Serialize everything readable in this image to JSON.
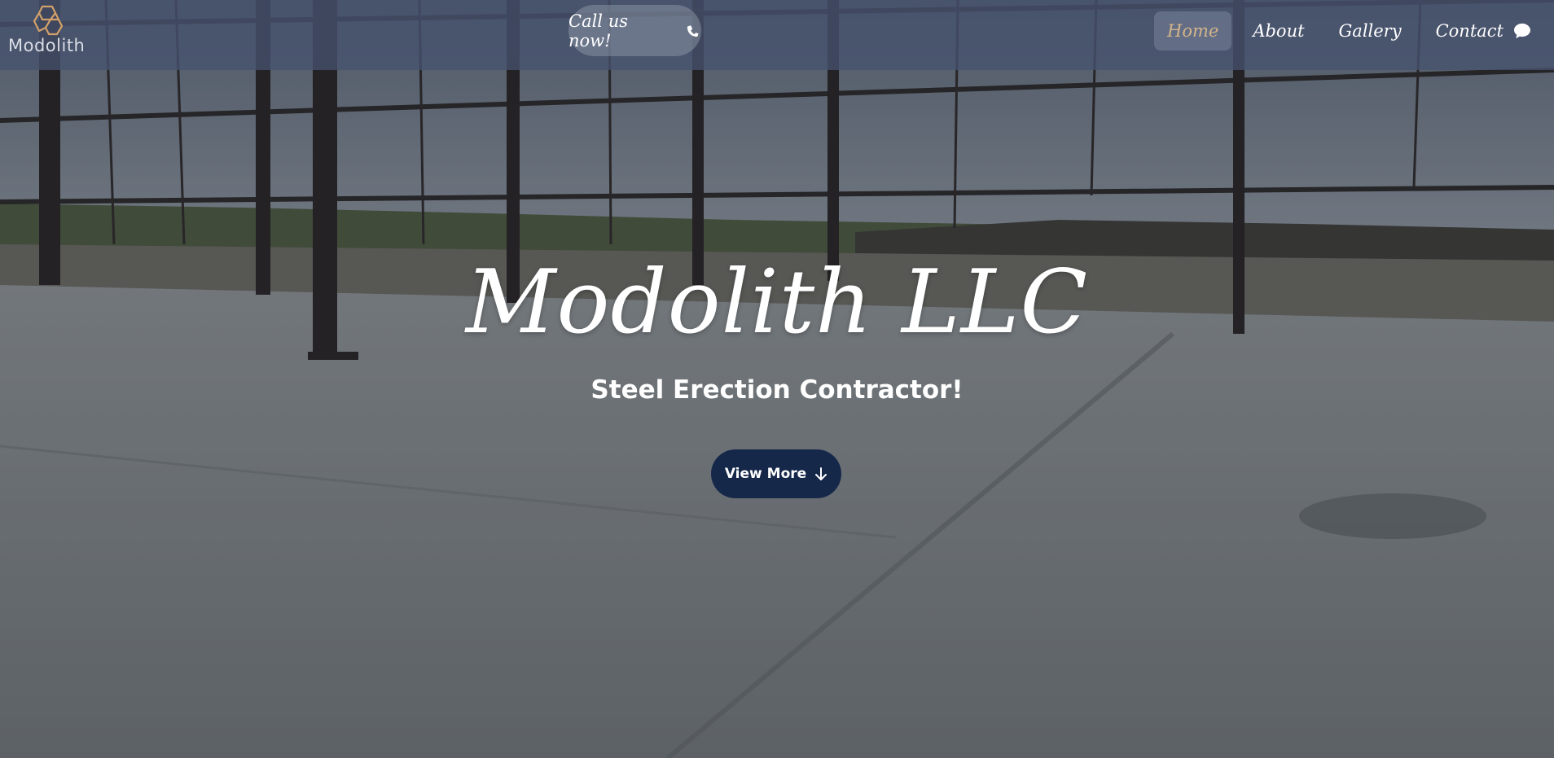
{
  "brand": {
    "name": "Modolith"
  },
  "header": {
    "call_label": "Call us now!",
    "call_icon": "phone-icon",
    "nav": [
      {
        "label": "Home",
        "active": true
      },
      {
        "label": "About",
        "active": false
      },
      {
        "label": "Gallery",
        "active": false
      },
      {
        "label": "Contact",
        "icon": "chat-bubble-icon",
        "active": false
      }
    ]
  },
  "hero": {
    "title": "Modolith LLC",
    "subtitle": "Steel Erection Contractor!",
    "cta_label": "View More",
    "cta_icon": "arrow-down-icon"
  },
  "colors": {
    "header_bg": "#46526e",
    "nav_active_text": "#d5b48a",
    "cta_bg": "#16284a",
    "text": "#ffffff"
  }
}
